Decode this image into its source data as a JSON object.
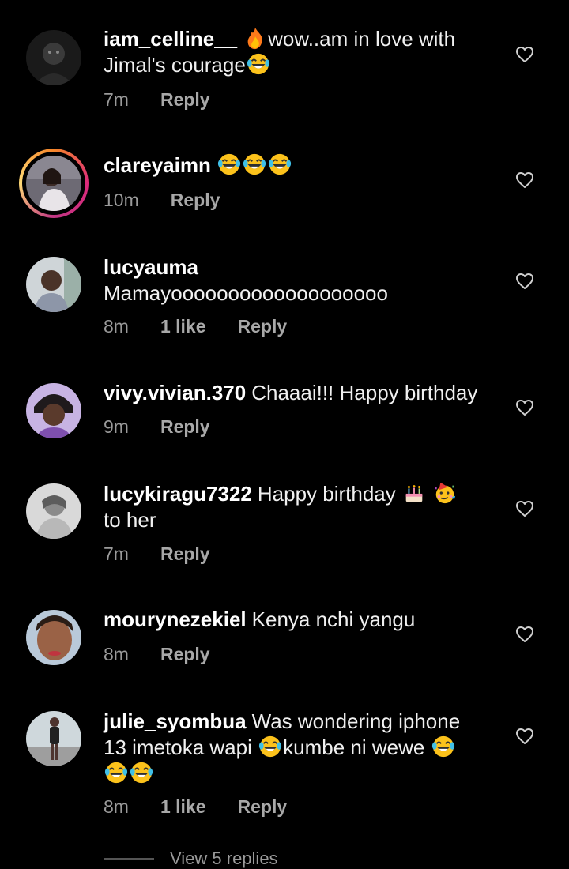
{
  "comments": [
    {
      "username": "iam_celline__",
      "text_a": "wow..am in love with",
      "text_b": "Jimal's courage",
      "time": "7m",
      "reply": "Reply",
      "avatar": "dark-masked-avatar"
    },
    {
      "username": "clareyaimn",
      "time": "10m",
      "reply": "Reply",
      "avatar": "woman-story-avatar",
      "has_story": true
    },
    {
      "username": "lucyauma",
      "text": "Mamayooooooooooooooooooo",
      "time": "8m",
      "likes": "1 like",
      "reply": "Reply",
      "avatar": "woman-photo-avatar"
    },
    {
      "username": "vivy.vivian.370",
      "text": "Chaaai!!! Happy birthday",
      "time": "9m",
      "reply": "Reply",
      "avatar": "woman-purple-avatar"
    },
    {
      "username": "lucykiragu7322",
      "text_a": "Happy birthday",
      "text_b": "to her",
      "time": "7m",
      "reply": "Reply",
      "avatar": "grayscale-avatar"
    },
    {
      "username": "mourynezekiel",
      "text": "Kenya nchi yangu",
      "time": "8m",
      "reply": "Reply",
      "avatar": "woman-closeup-avatar"
    },
    {
      "username": "julie_syombua",
      "text_a": "Was wondering iphone",
      "text_b": "13 imetoka wapi",
      "text_c": "kumbe ni wewe",
      "time": "8m",
      "likes": "1 like",
      "reply": "Reply",
      "avatar": "full-body-avatar"
    }
  ],
  "view_replies": "View 5 replies",
  "colors": {
    "background": "#000000",
    "username": "#ffffff",
    "meta": "#9a9a9a"
  },
  "icons": [
    "heart-outline-icon",
    "laughing-tears-emoji",
    "fire-emoji",
    "birthday-cake-emoji",
    "party-face-emoji"
  ]
}
